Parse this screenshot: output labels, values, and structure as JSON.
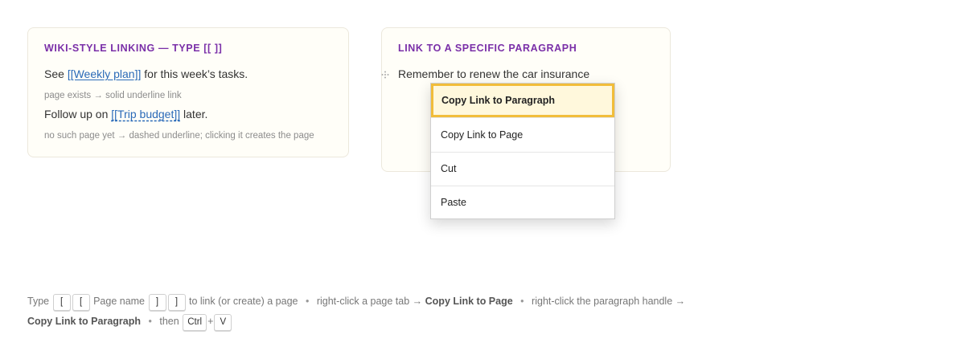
{
  "wiki_card": {
    "title": "WIKI-STYLE LINKING — TYPE [[ ]]",
    "line1_prefix": "See ",
    "line1_link": "[[Weekly plan]]",
    "line1_suffix": " for this week’s tasks.",
    "hint1": "page exists → solid underline link",
    "line2_prefix": "Follow up on ",
    "line2_link": "[[Trip budget]]",
    "line2_suffix": " later.",
    "hint2": "no such page yet → dashed underline; clicking it creates the page"
  },
  "para_card": {
    "title": "LINK TO A SPECIFIC PARAGRAPH",
    "paragraph": "Remember to renew the car insurance",
    "handle_icon": "drag-handle-icon"
  },
  "context_menu": {
    "items": [
      {
        "label": "Copy Link to Paragraph",
        "highlighted": true
      },
      {
        "label": "Copy Link to Page",
        "highlighted": false
      },
      {
        "label": "Cut",
        "highlighted": false
      },
      {
        "label": "Paste",
        "highlighted": false
      }
    ]
  },
  "footer": {
    "type": "Type",
    "k1": "[",
    "k2": "[",
    "page_name": "Page name",
    "k3": "]",
    "k4": "]",
    "to_link": "to link (or create) a page",
    "sep": "•",
    "right_click_tab": "right-click a page tab →",
    "copy_link_page": "Copy Link to Page",
    "right_click_para": "right-click the paragraph handle →",
    "copy_link_para": "Copy Link to Paragraph",
    "then": "then",
    "ctrl": "Ctrl",
    "plus": "+",
    "v": "V"
  },
  "colors": {
    "title_purple": "#7a2fa8",
    "link_blue": "#2a6ab8",
    "highlight_border": "#f1bd3a",
    "highlight_bg": "#fff8dc"
  }
}
